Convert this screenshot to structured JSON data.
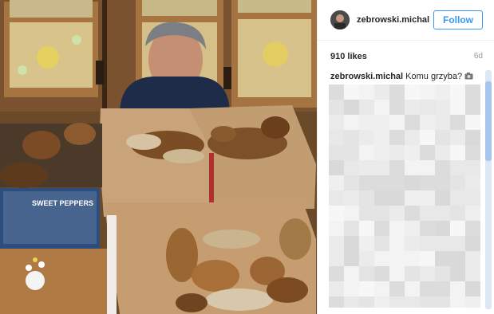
{
  "post": {
    "author": {
      "username": "zebrowski.michal",
      "avatar_icon": "profile-avatar"
    },
    "follow_label": "Follow",
    "likes": "910 likes",
    "age": "6d",
    "caption": {
      "username": "zebrowski.michal",
      "text": "Komu grzyba?",
      "emoji_icon": "camera-emoji-icon"
    },
    "photo": {
      "box_label": "SWEET PEPPERS",
      "icon": "mushroom-photo"
    },
    "comments_obscured": true
  },
  "colors": {
    "accent": "#3897f0",
    "text": "#262626",
    "muted": "#999999"
  }
}
